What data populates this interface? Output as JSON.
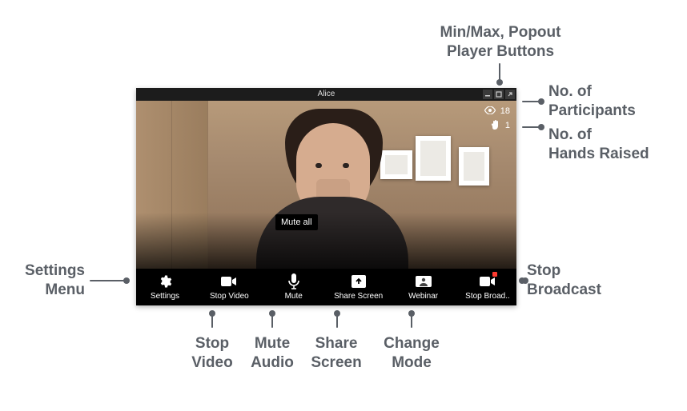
{
  "annotations": {
    "minmax": "Min/Max, Popout\nPlayer Buttons",
    "participants": "No. of\nParticipants",
    "hands": "No. of\nHands Raised",
    "settings": "Settings\nMenu",
    "stopvideo": "Stop\nVideo",
    "muteaudio": "Mute\nAudio",
    "sharescreen": "Share\nScreen",
    "changemode": "Change\nMode",
    "stopbroadcast": "Stop\nBroadcast"
  },
  "player": {
    "title": "Alice",
    "tooltip": "Mute all",
    "stats": {
      "viewers": "18",
      "hands": "1"
    },
    "toolbar": {
      "settings": "Settings",
      "stopvideo": "Stop Video",
      "mute": "Mute",
      "sharescreen": "Share Screen",
      "webinar": "Webinar",
      "stopbroadcast": "Stop Broad.."
    }
  }
}
